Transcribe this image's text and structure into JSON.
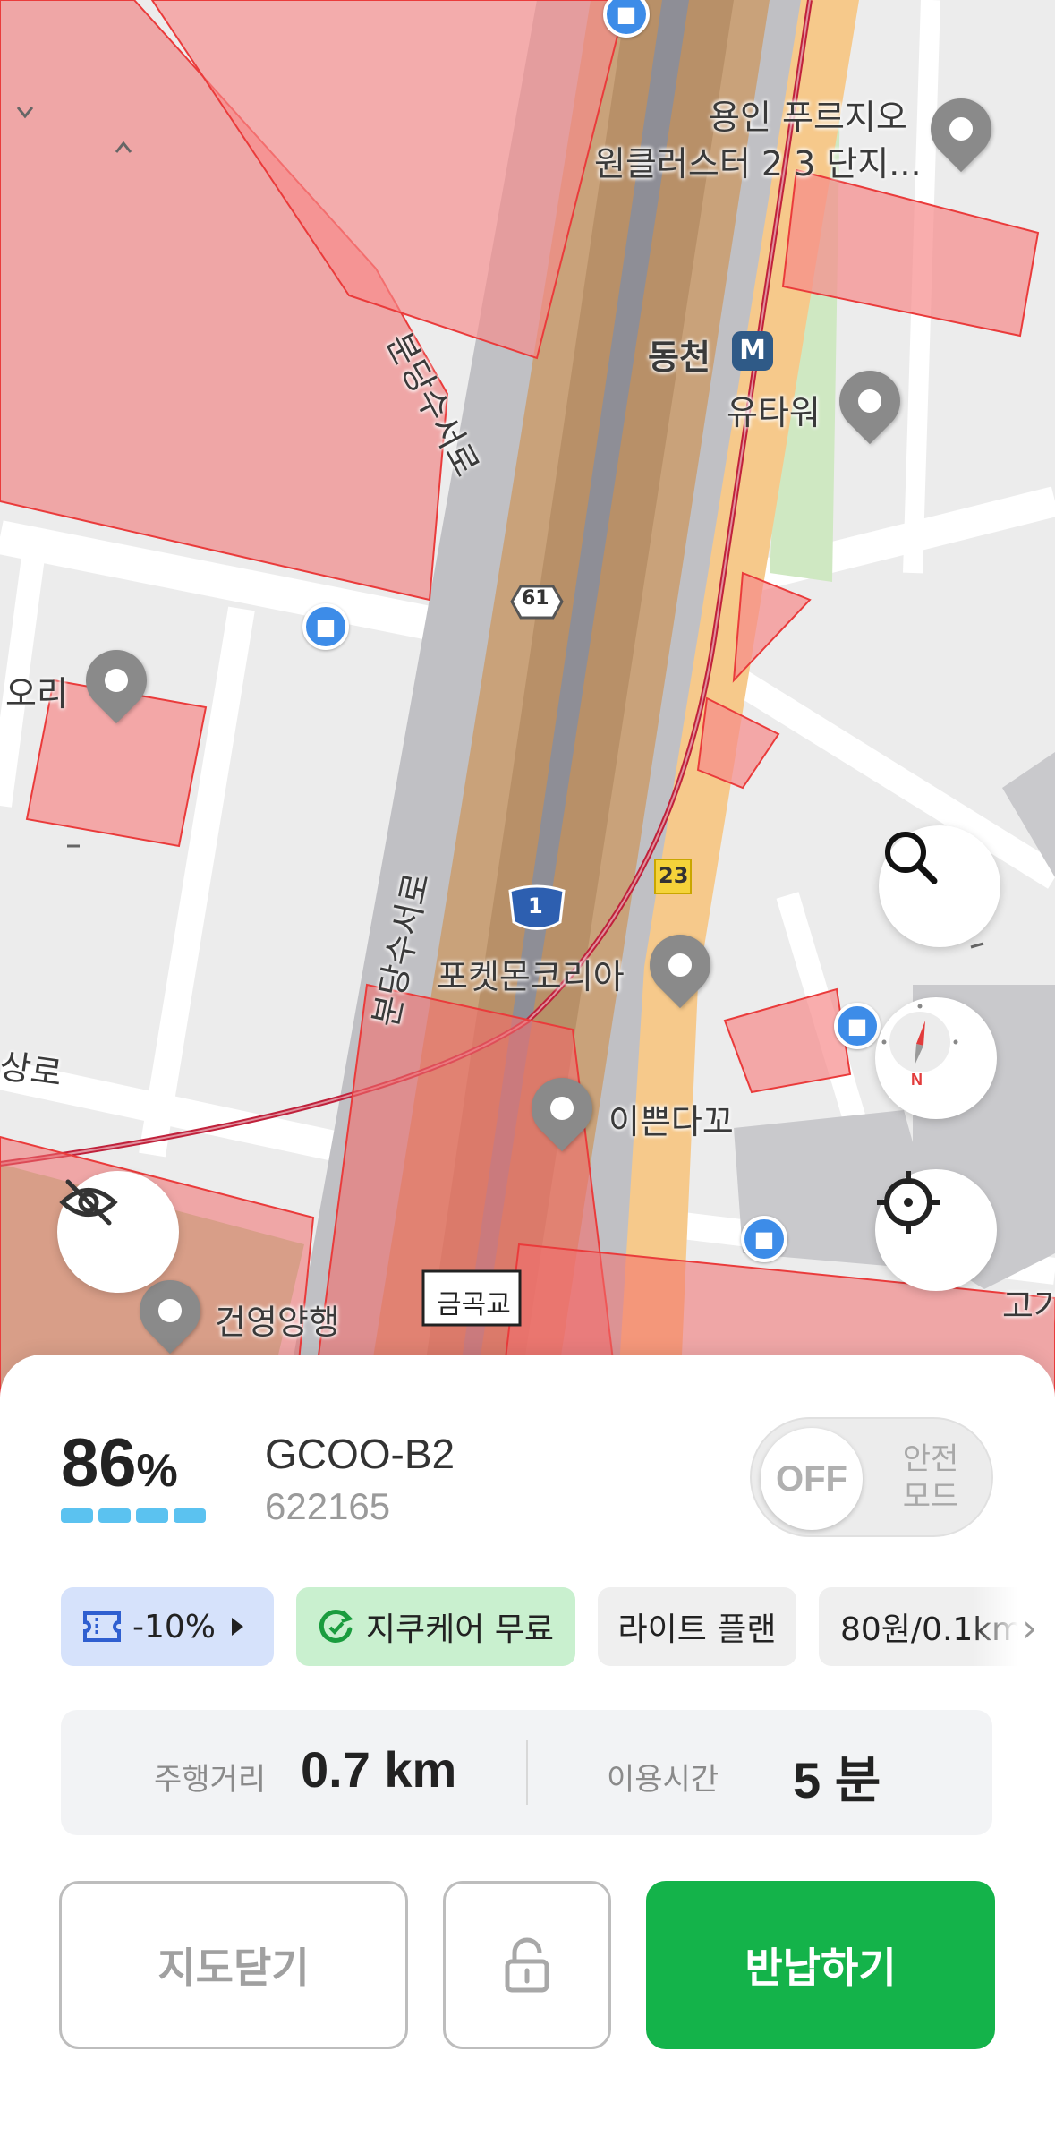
{
  "map": {
    "labels": {
      "poi_yongin": "용인 푸르지오",
      "poi_yongin_2": "원클러스터 2 3 단지...",
      "station": "동천",
      "station_badge": "M",
      "utower": "유타워",
      "road_bundang_top": "분당수서로",
      "road_bundang_bottom": "분당수서로",
      "road_61": "61",
      "road_1": "1",
      "road_23": "23",
      "pokemon": "포켓몬코리아",
      "ippeun": "이쁜다꼬",
      "ori": "오리",
      "geonyeong": "건영양행",
      "sangro": "상로",
      "gogi": "고기",
      "bridge": "금곡교"
    },
    "buttons": [
      "hide-map-button",
      "search-button",
      "compass-button",
      "locate-button"
    ]
  },
  "vehicle": {
    "battery_value": "86",
    "battery_unit": "%",
    "battery_level": 0.86,
    "name": "GCOO-B2",
    "id": "622165"
  },
  "safe_mode": {
    "state": "OFF",
    "label_line1": "안전",
    "label_line2": "모드"
  },
  "chips": {
    "coupon": "-10%",
    "care": "지쿠케어 무료",
    "plan": "라이트 플랜",
    "price": "80원/0.1km"
  },
  "stats": {
    "distance_label": "주행거리",
    "distance_value": "0.7 km",
    "time_label": "이용시간",
    "time_value": "5 분"
  },
  "actions": {
    "close_map": "지도닫기",
    "return": "반납하기"
  },
  "colors": {
    "accent_green": "#14b34a",
    "zone_red": "#f26d6d",
    "battery_blue": "#5bc2f0"
  }
}
